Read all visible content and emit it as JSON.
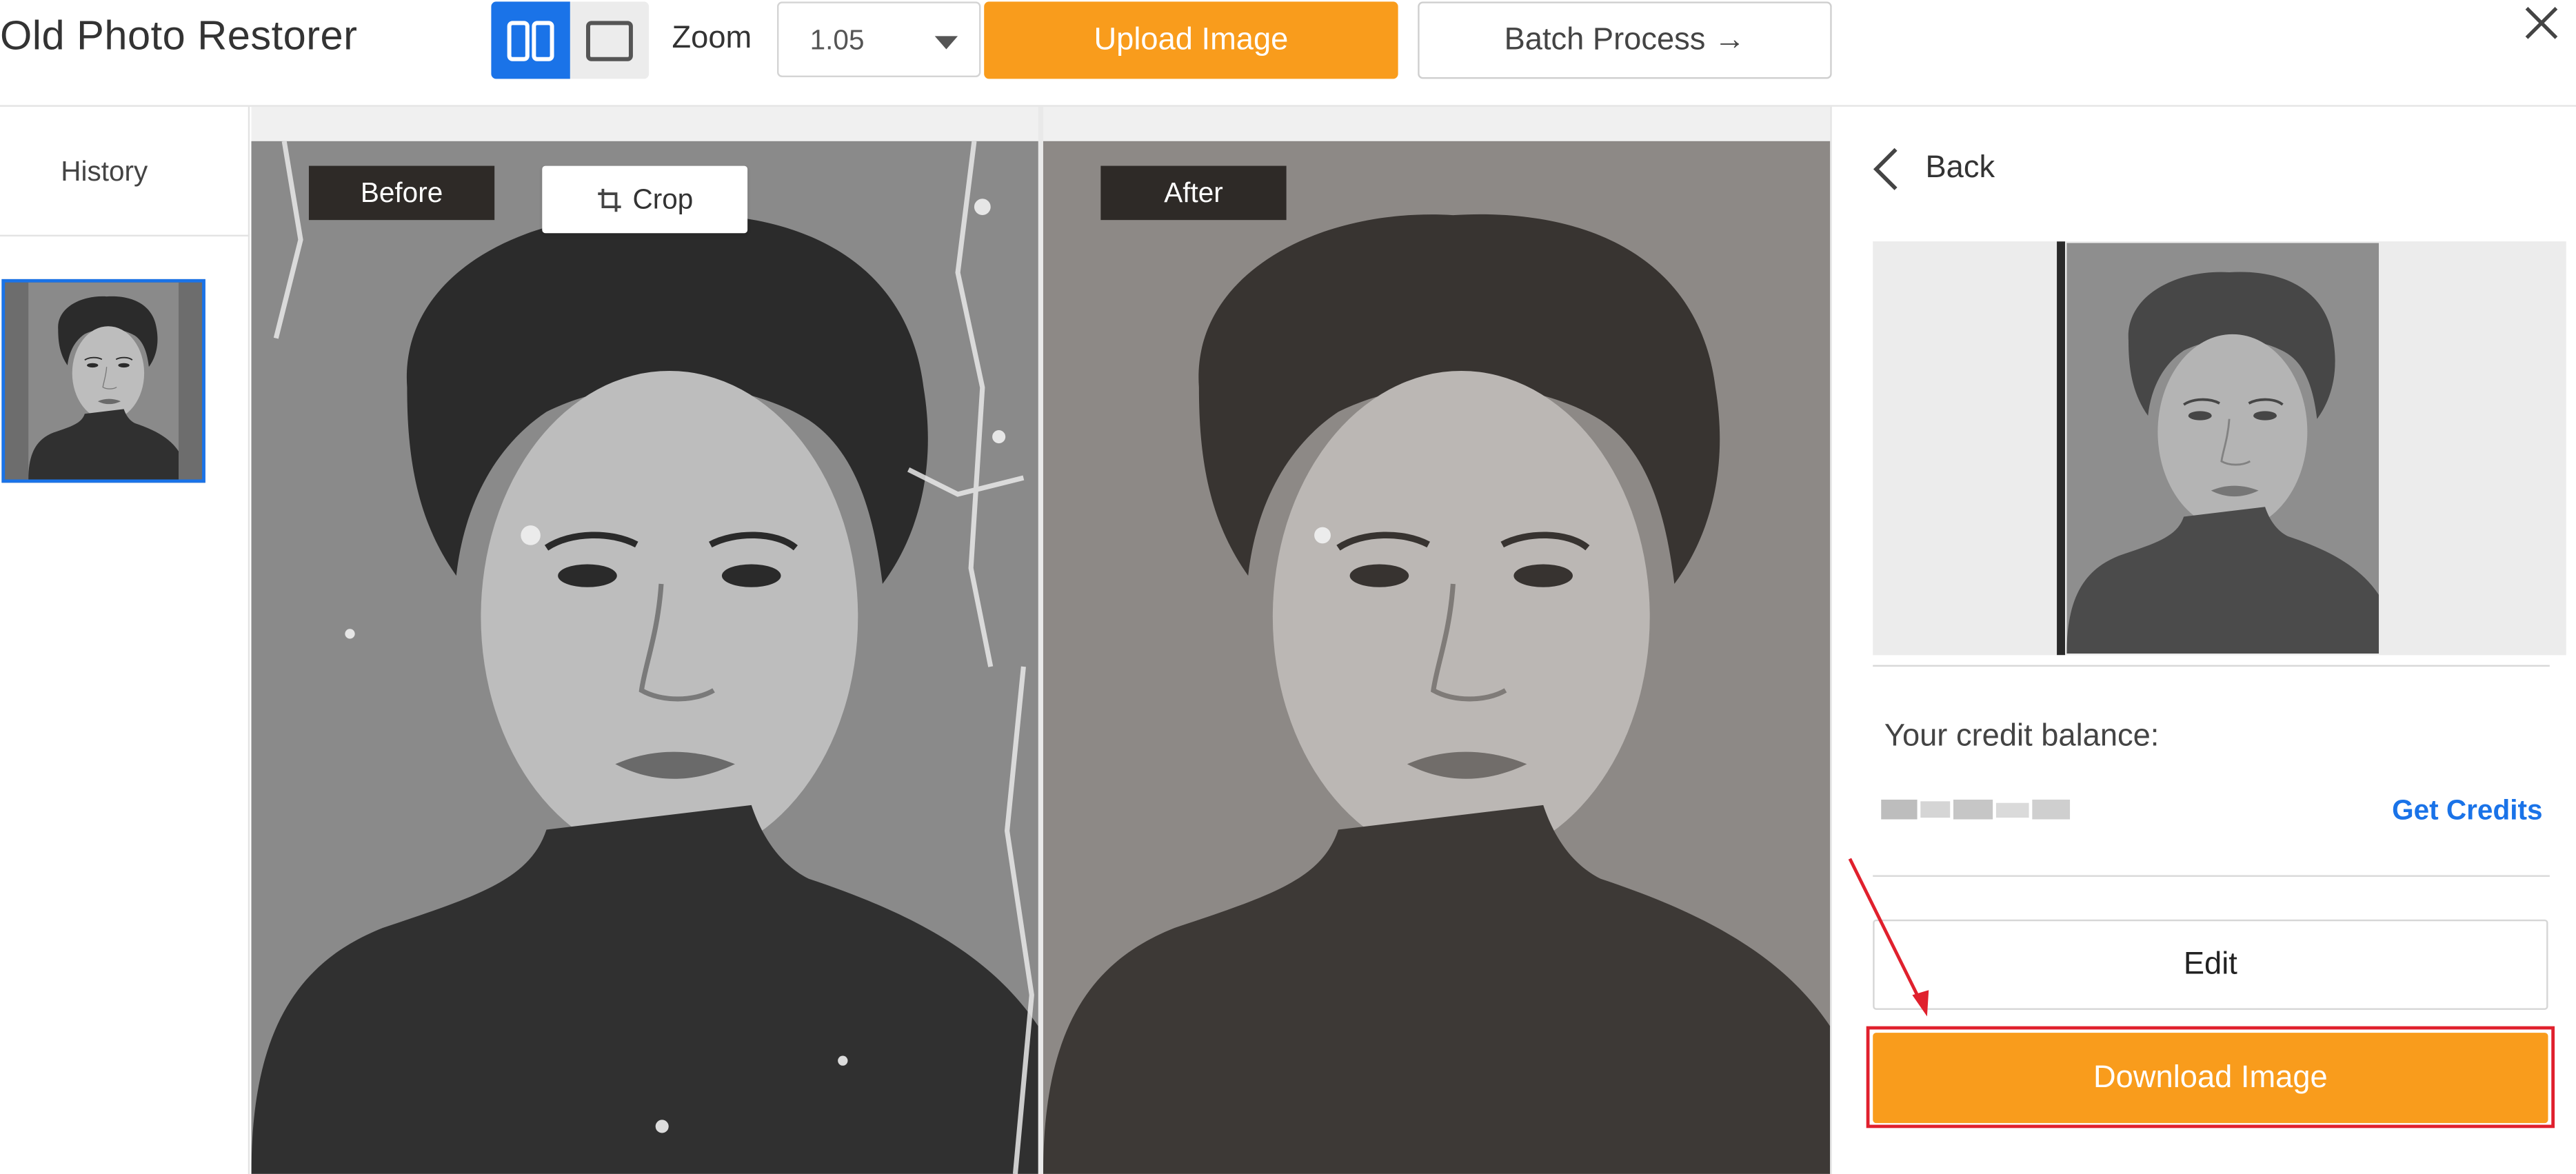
{
  "app": {
    "title": "Old Photo Restorer"
  },
  "toolbar": {
    "zoom_label": "Zoom",
    "zoom_value": "1.05",
    "upload_label": "Upload Image",
    "batch_label": "Batch Process →",
    "view_modes": [
      "split-view-icon",
      "single-view-icon"
    ]
  },
  "sidebar": {
    "history_label": "History"
  },
  "compare": {
    "before_label": "Before",
    "after_label": "After",
    "crop_label": "Crop"
  },
  "panel": {
    "back_label": "Back",
    "credit_label": "Your credit balance:",
    "get_credits_label": "Get Credits",
    "edit_label": "Edit",
    "download_label": "Download Image"
  },
  "colors": {
    "accent_blue": "#1a73e8",
    "action_orange": "#f99c1c",
    "annotation_red": "#e0202d"
  }
}
